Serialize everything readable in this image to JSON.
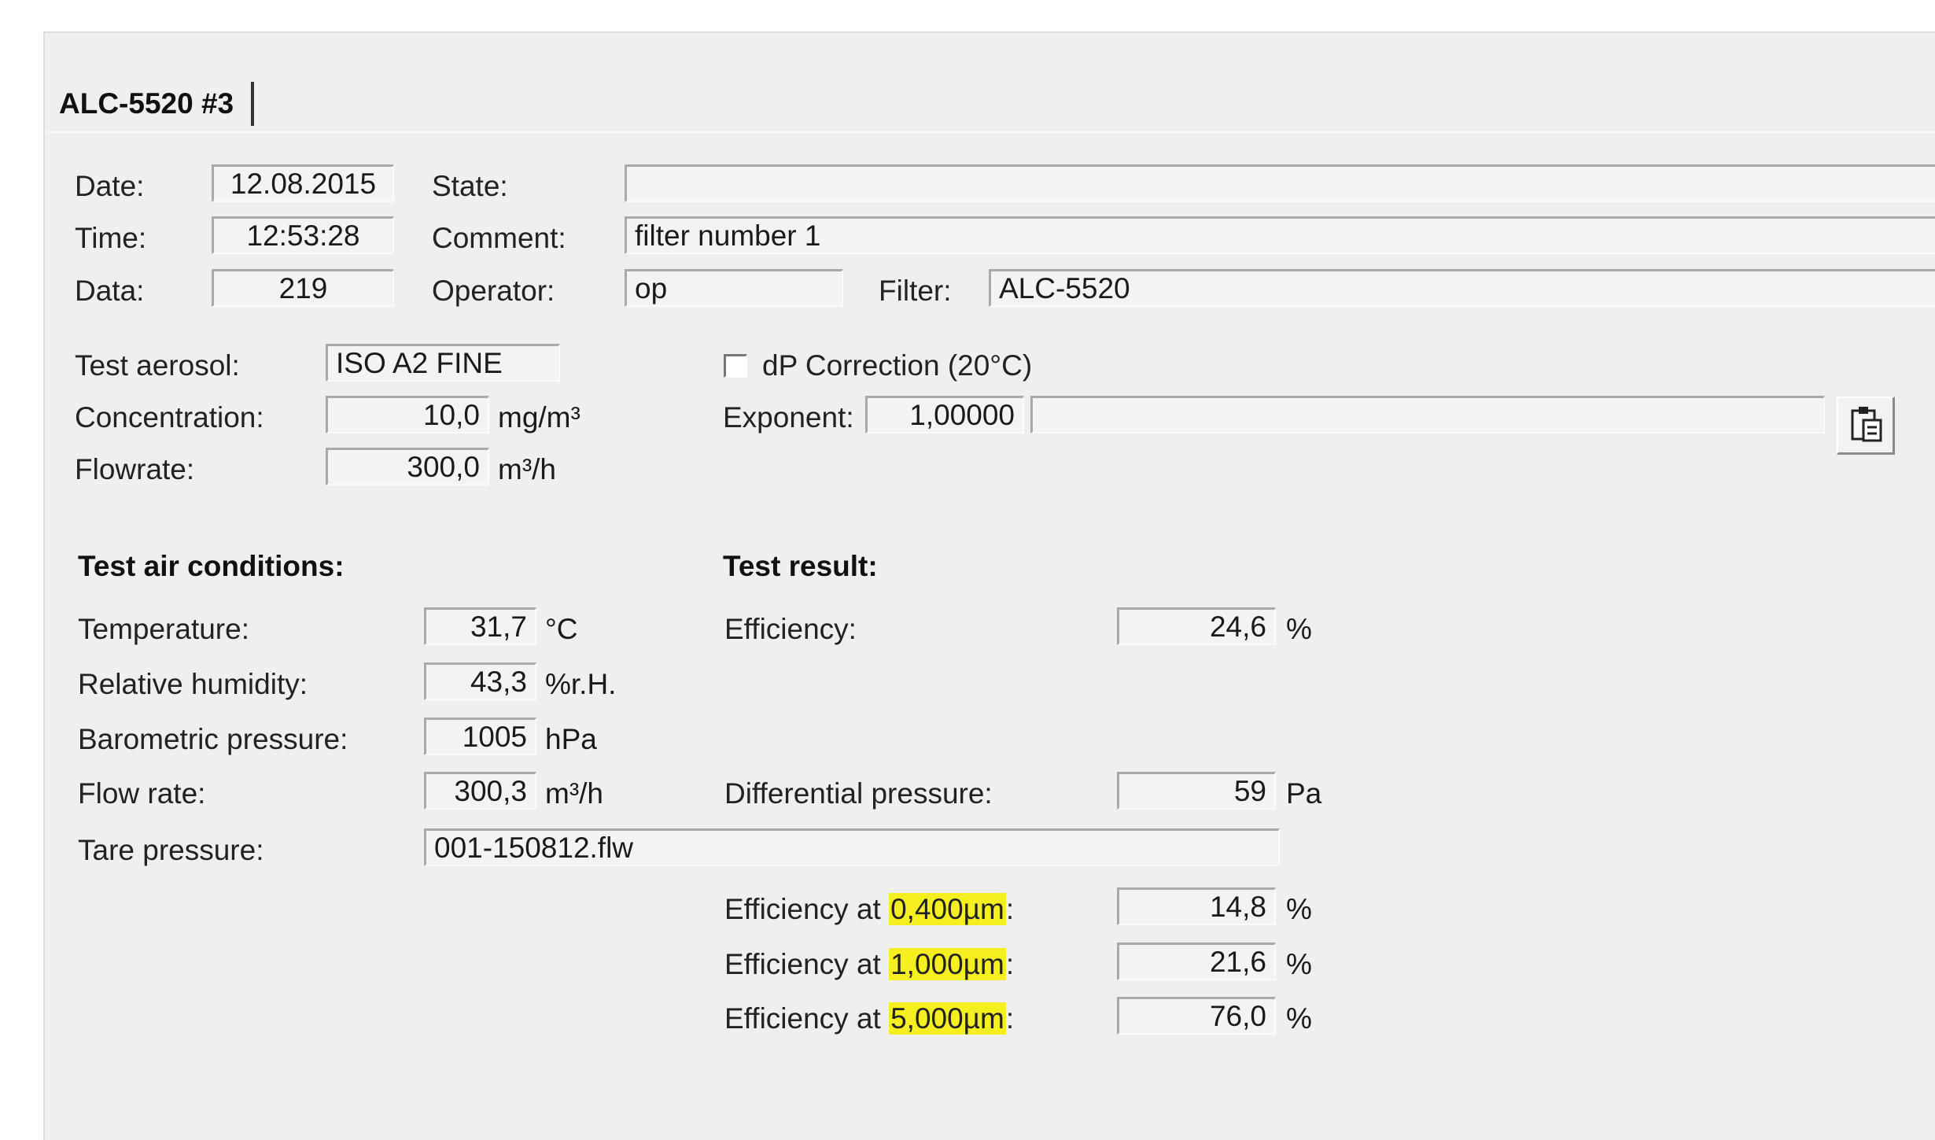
{
  "tab": {
    "label": "ALC-5520  #3"
  },
  "header": {
    "date_label": "Date:",
    "date_value": "12.08.2015",
    "time_label": "Time:",
    "time_value": "12:53:28",
    "data_label": "Data:",
    "data_value": "219",
    "state_label": "State:",
    "state_value": "",
    "comment_label": "Comment:",
    "comment_value": "filter number 1",
    "operator_label": "Operator:",
    "operator_value": "op",
    "filter_label": "Filter:",
    "filter_value": "ALC-5520"
  },
  "aerosol": {
    "test_aerosol_label": "Test aerosol:",
    "test_aerosol_value": "ISO A2 FINE",
    "concentration_label": "Concentration:",
    "concentration_value": "10,0",
    "concentration_unit": "mg/m³",
    "flowrate_label": "Flowrate:",
    "flowrate_value": "300,0",
    "flowrate_unit": "m³/h",
    "dp_correction_label": "dP Correction (20°C)",
    "dp_correction_checked": false,
    "exponent_label": "Exponent:",
    "exponent_value": "1,00000",
    "exponent_bar_value": "",
    "clipboard_icon": "clipboard-icon"
  },
  "air_conditions": {
    "title": "Test air conditions:",
    "temperature_label": "Temperature:",
    "temperature_value": "31,7",
    "temperature_unit": "°C",
    "humidity_label": "Relative humidity:",
    "humidity_value": "43,3",
    "humidity_unit": "%r.H.",
    "pressure_label": "Barometric pressure:",
    "pressure_value": "1005",
    "pressure_unit": "hPa",
    "flow_rate_label": "Flow rate:",
    "flow_rate_value": "300,3",
    "flow_rate_unit": "m³/h",
    "tare_label": "Tare pressure:",
    "tare_value": "001-150812.flw"
  },
  "result": {
    "title": "Test result:",
    "efficiency_label": "Efficiency:",
    "efficiency_value": "24,6",
    "efficiency_unit": "%",
    "dp_label": "Differential pressure:",
    "dp_value": "59",
    "dp_unit": "Pa",
    "eff_at_prefix": "Efficiency at",
    "rows": [
      {
        "size": "0,400µm",
        "suffix": ":",
        "value": "14,8",
        "unit": "%"
      },
      {
        "size": "1,000µm",
        "suffix": ":",
        "value": "21,6",
        "unit": "%"
      },
      {
        "size": "5,000µm",
        "suffix": ":",
        "value": "76,0",
        "unit": "%"
      }
    ],
    "highlight_color": "#f6ef1f"
  }
}
